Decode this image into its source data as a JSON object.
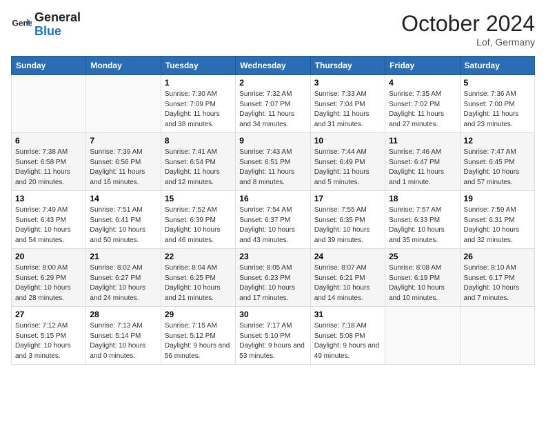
{
  "header": {
    "logo_general": "General",
    "logo_blue": "Blue",
    "month": "October 2024",
    "location": "Lof, Germany"
  },
  "days_of_week": [
    "Sunday",
    "Monday",
    "Tuesday",
    "Wednesday",
    "Thursday",
    "Friday",
    "Saturday"
  ],
  "weeks": [
    [
      {
        "day": "",
        "info": ""
      },
      {
        "day": "",
        "info": ""
      },
      {
        "day": "1",
        "info": "Sunrise: 7:30 AM\nSunset: 7:09 PM\nDaylight: 11 hours\nand 38 minutes."
      },
      {
        "day": "2",
        "info": "Sunrise: 7:32 AM\nSunset: 7:07 PM\nDaylight: 11 hours\nand 34 minutes."
      },
      {
        "day": "3",
        "info": "Sunrise: 7:33 AM\nSunset: 7:04 PM\nDaylight: 11 hours\nand 31 minutes."
      },
      {
        "day": "4",
        "info": "Sunrise: 7:35 AM\nSunset: 7:02 PM\nDaylight: 11 hours\nand 27 minutes."
      },
      {
        "day": "5",
        "info": "Sunrise: 7:36 AM\nSunset: 7:00 PM\nDaylight: 11 hours\nand 23 minutes."
      }
    ],
    [
      {
        "day": "6",
        "info": "Sunrise: 7:38 AM\nSunset: 6:58 PM\nDaylight: 11 hours\nand 20 minutes."
      },
      {
        "day": "7",
        "info": "Sunrise: 7:39 AM\nSunset: 6:56 PM\nDaylight: 11 hours\nand 16 minutes."
      },
      {
        "day": "8",
        "info": "Sunrise: 7:41 AM\nSunset: 6:54 PM\nDaylight: 11 hours\nand 12 minutes."
      },
      {
        "day": "9",
        "info": "Sunrise: 7:43 AM\nSunset: 6:51 PM\nDaylight: 11 hours\nand 8 minutes."
      },
      {
        "day": "10",
        "info": "Sunrise: 7:44 AM\nSunset: 6:49 PM\nDaylight: 11 hours\nand 5 minutes."
      },
      {
        "day": "11",
        "info": "Sunrise: 7:46 AM\nSunset: 6:47 PM\nDaylight: 11 hours\nand 1 minute."
      },
      {
        "day": "12",
        "info": "Sunrise: 7:47 AM\nSunset: 6:45 PM\nDaylight: 10 hours\nand 57 minutes."
      }
    ],
    [
      {
        "day": "13",
        "info": "Sunrise: 7:49 AM\nSunset: 6:43 PM\nDaylight: 10 hours\nand 54 minutes."
      },
      {
        "day": "14",
        "info": "Sunrise: 7:51 AM\nSunset: 6:41 PM\nDaylight: 10 hours\nand 50 minutes."
      },
      {
        "day": "15",
        "info": "Sunrise: 7:52 AM\nSunset: 6:39 PM\nDaylight: 10 hours\nand 46 minutes."
      },
      {
        "day": "16",
        "info": "Sunrise: 7:54 AM\nSunset: 6:37 PM\nDaylight: 10 hours\nand 43 minutes."
      },
      {
        "day": "17",
        "info": "Sunrise: 7:55 AM\nSunset: 6:35 PM\nDaylight: 10 hours\nand 39 minutes."
      },
      {
        "day": "18",
        "info": "Sunrise: 7:57 AM\nSunset: 6:33 PM\nDaylight: 10 hours\nand 35 minutes."
      },
      {
        "day": "19",
        "info": "Sunrise: 7:59 AM\nSunset: 6:31 PM\nDaylight: 10 hours\nand 32 minutes."
      }
    ],
    [
      {
        "day": "20",
        "info": "Sunrise: 8:00 AM\nSunset: 6:29 PM\nDaylight: 10 hours\nand 28 minutes."
      },
      {
        "day": "21",
        "info": "Sunrise: 8:02 AM\nSunset: 6:27 PM\nDaylight: 10 hours\nand 24 minutes."
      },
      {
        "day": "22",
        "info": "Sunrise: 8:04 AM\nSunset: 6:25 PM\nDaylight: 10 hours\nand 21 minutes."
      },
      {
        "day": "23",
        "info": "Sunrise: 8:05 AM\nSunset: 6:23 PM\nDaylight: 10 hours\nand 17 minutes."
      },
      {
        "day": "24",
        "info": "Sunrise: 8:07 AM\nSunset: 6:21 PM\nDaylight: 10 hours\nand 14 minutes."
      },
      {
        "day": "25",
        "info": "Sunrise: 8:08 AM\nSunset: 6:19 PM\nDaylight: 10 hours\nand 10 minutes."
      },
      {
        "day": "26",
        "info": "Sunrise: 8:10 AM\nSunset: 6:17 PM\nDaylight: 10 hours\nand 7 minutes."
      }
    ],
    [
      {
        "day": "27",
        "info": "Sunrise: 7:12 AM\nSunset: 5:15 PM\nDaylight: 10 hours\nand 3 minutes."
      },
      {
        "day": "28",
        "info": "Sunrise: 7:13 AM\nSunset: 5:14 PM\nDaylight: 10 hours\nand 0 minutes."
      },
      {
        "day": "29",
        "info": "Sunrise: 7:15 AM\nSunset: 5:12 PM\nDaylight: 9 hours\nand 56 minutes."
      },
      {
        "day": "30",
        "info": "Sunrise: 7:17 AM\nSunset: 5:10 PM\nDaylight: 9 hours\nand 53 minutes."
      },
      {
        "day": "31",
        "info": "Sunrise: 7:18 AM\nSunset: 5:08 PM\nDaylight: 9 hours\nand 49 minutes."
      },
      {
        "day": "",
        "info": ""
      },
      {
        "day": "",
        "info": ""
      }
    ]
  ]
}
